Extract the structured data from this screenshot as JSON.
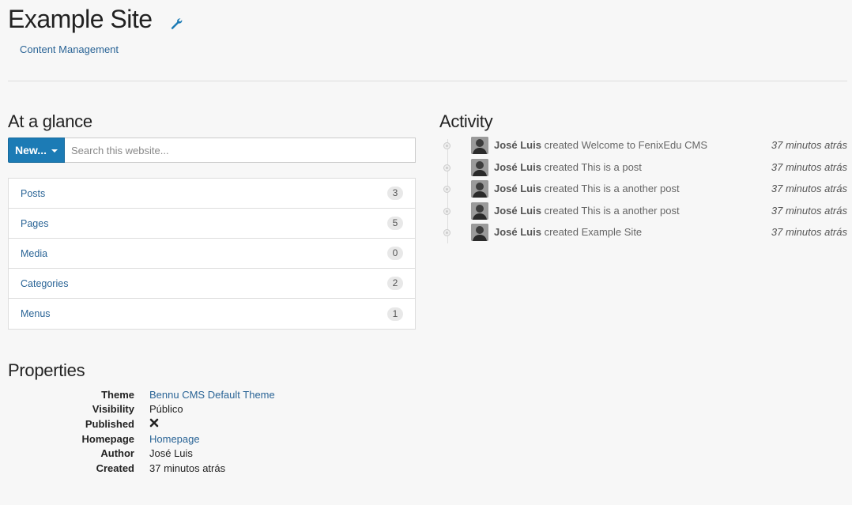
{
  "site": {
    "title": "Example Site",
    "breadcrumb": "Content Management"
  },
  "glance": {
    "title": "At a glance",
    "new_button": "New...",
    "search_placeholder": "Search this website...",
    "items": [
      {
        "label": "Posts",
        "count": "3"
      },
      {
        "label": "Pages",
        "count": "5"
      },
      {
        "label": "Media",
        "count": "0"
      },
      {
        "label": "Categories",
        "count": "2"
      },
      {
        "label": "Menus",
        "count": "1"
      }
    ]
  },
  "activity": {
    "title": "Activity",
    "items": [
      {
        "user": "José Luis",
        "action": "created Welcome to FenixEdu CMS",
        "time": "37 minutos atrás"
      },
      {
        "user": "José Luis",
        "action": "created This is a post",
        "time": "37 minutos atrás"
      },
      {
        "user": "José Luis",
        "action": "created This is a another post",
        "time": "37 minutos atrás"
      },
      {
        "user": "José Luis",
        "action": "created This is a another post",
        "time": "37 minutos atrás"
      },
      {
        "user": "José Luis",
        "action": "created Example Site",
        "time": "37 minutos atrás"
      }
    ]
  },
  "properties": {
    "title": "Properties",
    "theme_label": "Theme",
    "theme_value": "Bennu CMS Default Theme",
    "visibility_label": "Visibility",
    "visibility_value": "Público",
    "published_label": "Published",
    "published_icon": "times-icon",
    "homepage_label": "Homepage",
    "homepage_value": "Homepage",
    "author_label": "Author",
    "author_value": "José Luis",
    "created_label": "Created",
    "created_value": "37 minutos atrás"
  },
  "colors": {
    "primary": "#1c7bb5",
    "link": "#2a6496",
    "background": "#f7f7f7"
  }
}
